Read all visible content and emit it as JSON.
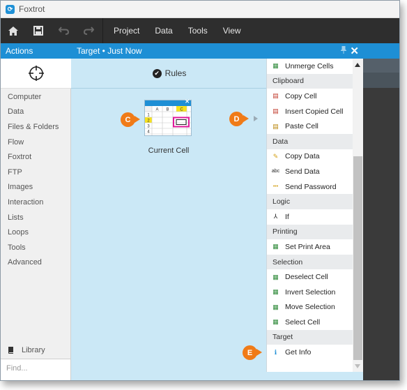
{
  "window": {
    "title": "Foxtrot"
  },
  "toolbar": {
    "menus": [
      "Project",
      "Data",
      "Tools",
      "View"
    ]
  },
  "actions": {
    "header": "Actions",
    "categories": [
      "Computer",
      "Data",
      "Files & Folders",
      "Flow",
      "Foxtrot",
      "FTP",
      "Images",
      "Interaction",
      "Lists",
      "Loops",
      "Tools",
      "Advanced"
    ],
    "library_label": "Library",
    "find_placeholder": "Find..."
  },
  "rules_panel": {
    "header": "Target  •  Just Now",
    "rules_label": "Rules",
    "cell_caption": "Current Cell",
    "thumb": {
      "cols": [
        "A",
        "B",
        "C"
      ],
      "rows": [
        "1",
        "2",
        "3",
        "4"
      ]
    }
  },
  "badges": {
    "c": "C",
    "d": "D",
    "e": "E"
  },
  "dropdown": {
    "items": [
      {
        "type": "item",
        "label": "Unmerge Cells",
        "icon": "unmerge-cells-icon"
      },
      {
        "type": "group",
        "label": "Clipboard"
      },
      {
        "type": "item",
        "label": "Copy Cell",
        "icon": "copy-cell-icon"
      },
      {
        "type": "item",
        "label": "Insert Copied Cell",
        "icon": "insert-copied-cell-icon"
      },
      {
        "type": "item",
        "label": "Paste Cell",
        "icon": "paste-cell-icon"
      },
      {
        "type": "group",
        "label": "Data"
      },
      {
        "type": "item",
        "label": "Copy Data",
        "icon": "copy-data-icon"
      },
      {
        "type": "item",
        "label": "Send Data",
        "icon": "send-data-icon"
      },
      {
        "type": "item",
        "label": "Send Password",
        "icon": "send-password-icon"
      },
      {
        "type": "group",
        "label": "Logic"
      },
      {
        "type": "item",
        "label": "If",
        "icon": "if-icon"
      },
      {
        "type": "group",
        "label": "Printing"
      },
      {
        "type": "item",
        "label": "Set Print Area",
        "icon": "set-print-area-icon"
      },
      {
        "type": "group",
        "label": "Selection"
      },
      {
        "type": "item",
        "label": "Deselect Cell",
        "icon": "deselect-cell-icon"
      },
      {
        "type": "item",
        "label": "Invert Selection",
        "icon": "invert-selection-icon"
      },
      {
        "type": "item",
        "label": "Move Selection",
        "icon": "move-selection-icon"
      },
      {
        "type": "item",
        "label": "Select Cell",
        "icon": "select-cell-icon"
      },
      {
        "type": "group",
        "label": "Target"
      },
      {
        "type": "item",
        "label": "Get Info",
        "icon": "get-info-icon"
      }
    ]
  },
  "colors": {
    "accent": "#1e8fd5",
    "badge": "#f07b18",
    "canvas": "#cbe8f6",
    "highlight_cell": "#e0189b"
  }
}
